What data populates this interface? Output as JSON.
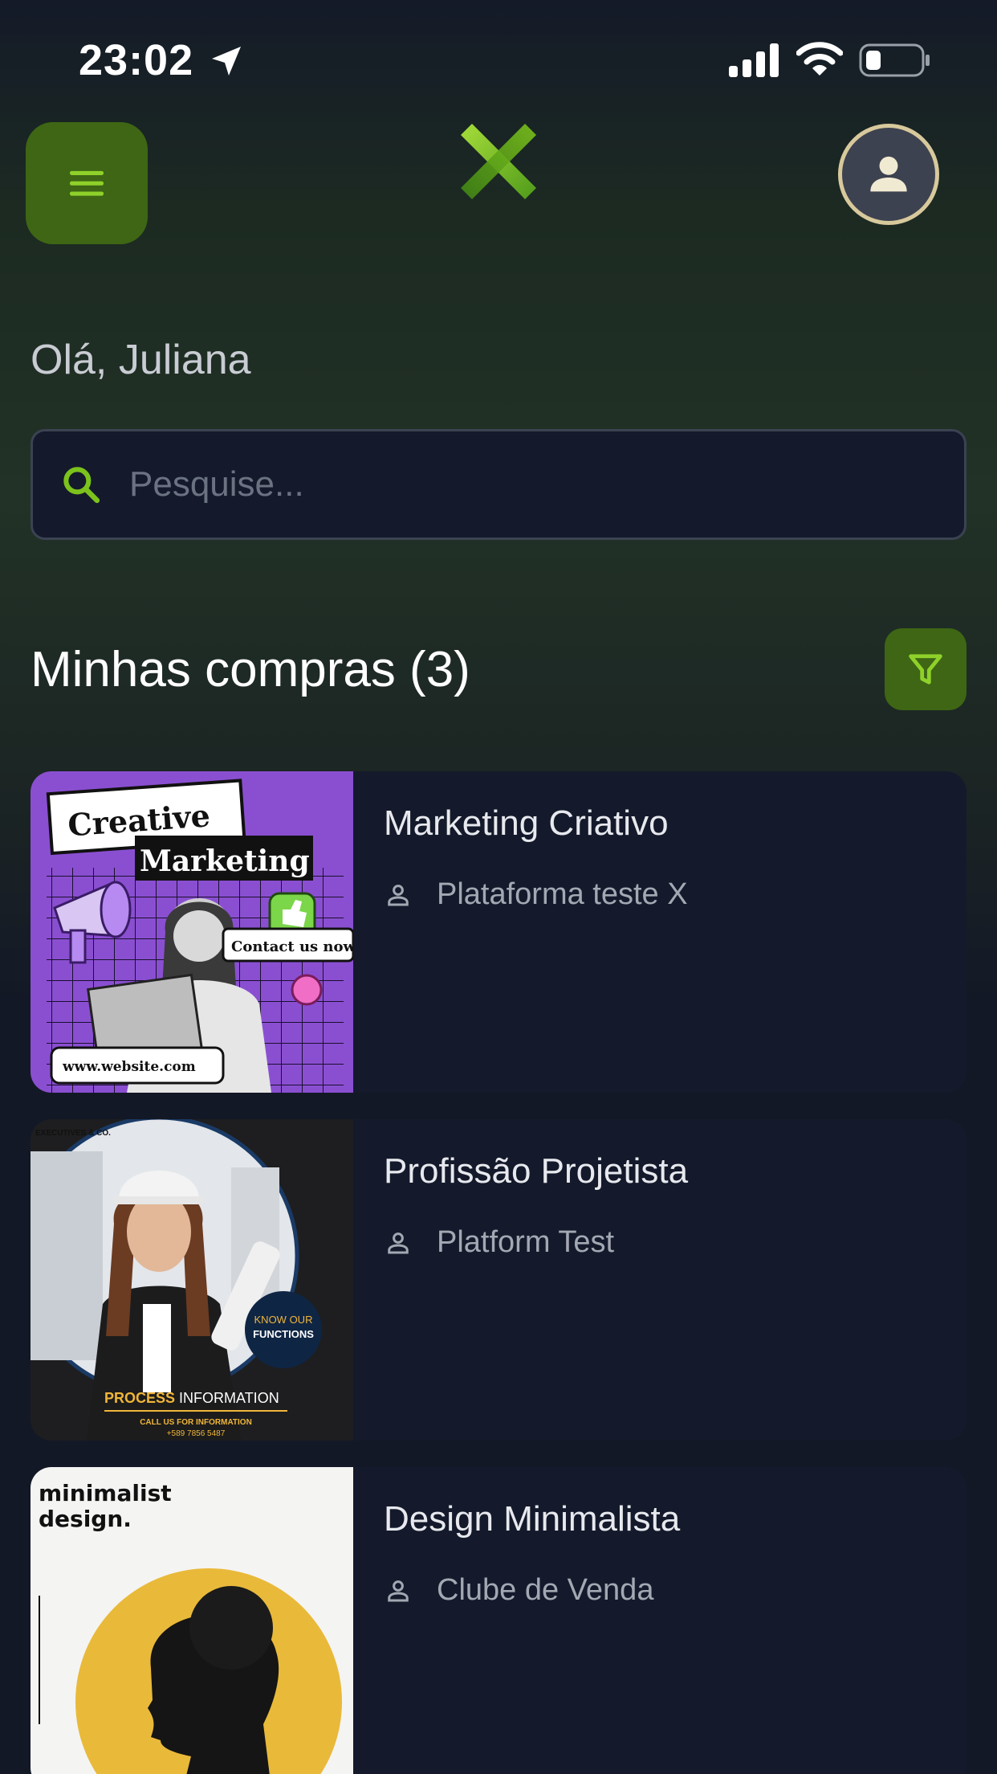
{
  "status_bar": {
    "time": "23:02"
  },
  "header": {
    "menu_icon": "hamburger-icon",
    "logo_icon": "x-logo-icon",
    "profile_icon": "user-icon"
  },
  "greeting": "Olá, Juliana",
  "search": {
    "placeholder": "Pesquise...",
    "value": ""
  },
  "purchases": {
    "title": "Minhas compras (3)",
    "filter_icon": "filter-icon",
    "items": [
      {
        "title": "Marketing Criativo",
        "platform": "Plataforma teste X",
        "thumb": {
          "line1": "Creative",
          "line2": "Marketing",
          "bubble": "Contact us now!",
          "url": "www.website.com"
        }
      },
      {
        "title": "Profissão Projetista",
        "platform": "Platform Test",
        "thumb": {
          "corner": "EXECUTIVES & CO.",
          "badge1": "KNOW OUR",
          "badge2": "FUNCTIONS",
          "headline_a": "PROCESS",
          "headline_b": " INFORMATION",
          "call": "CALL US FOR INFORMATION",
          "phone": "+589 7856 5487"
        }
      },
      {
        "title": "Design Minimalista",
        "platform": "Clube de Venda",
        "thumb": {
          "line1": "minimalist",
          "line2": "design."
        }
      }
    ]
  },
  "colors": {
    "accent_green": "#7cc21c",
    "button_green": "#3e6614",
    "background": "#131826",
    "card": "#141a2b"
  }
}
